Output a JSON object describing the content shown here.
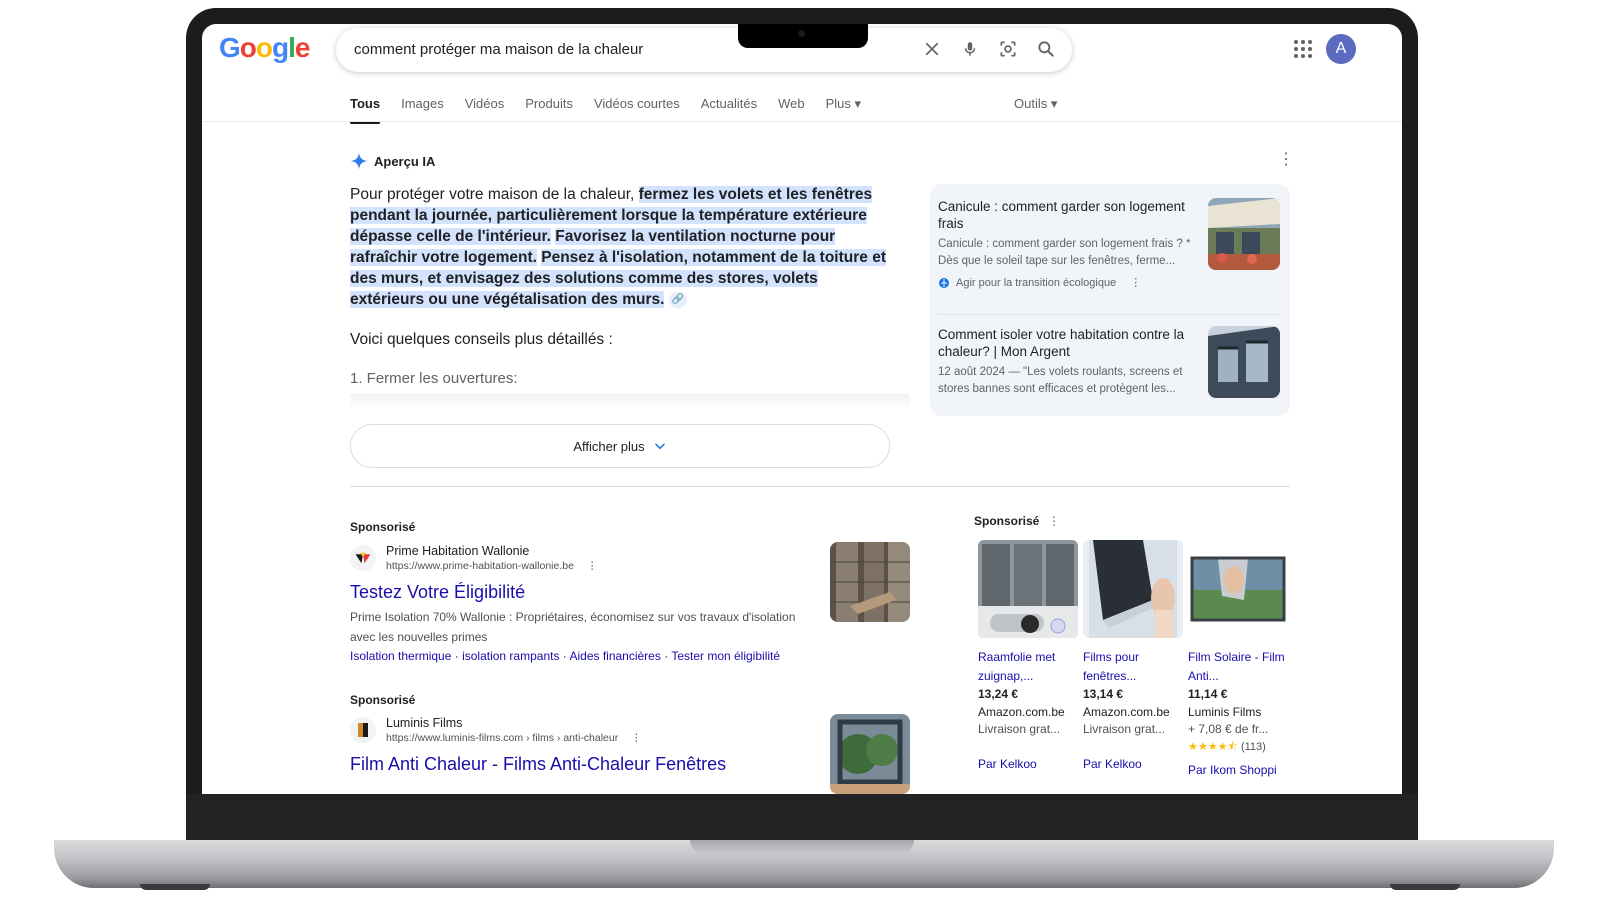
{
  "logo": {
    "letters": [
      "G",
      "o",
      "o",
      "g",
      "l",
      "e"
    ],
    "colors": [
      "#4285F4",
      "#EA4335",
      "#FBBC05",
      "#4285F4",
      "#34A853",
      "#EA4335"
    ]
  },
  "search": {
    "query": "comment protéger ma maison de la chaleur"
  },
  "account": {
    "avatar_letter": "A",
    "avatar_color": "#5c6bc0"
  },
  "tabs": [
    {
      "label": "Tous",
      "active": true
    },
    {
      "label": "Images"
    },
    {
      "label": "Vidéos"
    },
    {
      "label": "Produits"
    },
    {
      "label": "Vidéos courtes"
    },
    {
      "label": "Actualités"
    },
    {
      "label": "Web"
    },
    {
      "label": "Plus ▾"
    }
  ],
  "tools_label": "Outils ▾",
  "ai_overview": {
    "title": "Aperçu IA",
    "intro": "Pour protéger votre maison de la chaleur, ",
    "highlights": [
      "fermez les volets et les fenêtres pendant la journée, particulièrement lorsque la température extérieure dépasse celle de l'intérieur.",
      "Favorisez la ventilation nocturne pour rafraîchir votre logement.",
      "Pensez à l'isolation, notamment de la toiture et des murs, et envisagez des solutions comme des stores, volets extérieurs ou une végétalisation des murs."
    ],
    "subheading": "Voici quelques conseils plus détaillés :",
    "first_item": "1. Fermer les ouvertures:",
    "show_more": "Afficher plus"
  },
  "sources": [
    {
      "title": "Canicule : comment garder son logement frais",
      "snippet": "Canicule : comment garder son logement frais ? * Dès que le soleil tape sur les fenêtres, ferme...",
      "site": "Agir pour la transition écologique"
    },
    {
      "title": "Comment isoler votre habitation contre la chaleur? | Mon Argent",
      "snippet": "12 août 2024 — \"Les volets roulants, screens et stores bannes sont efficaces et protègent les..."
    }
  ],
  "ads": [
    {
      "label": "Sponsorisé",
      "advertiser": "Prime Habitation Wallonie",
      "url": "https://www.prime-habitation-wallonie.be",
      "title": "Testez Votre Éligibilité",
      "description": "Prime Isolation 70% Wallonie : Propriétaires, économisez sur vos travaux d'isolation avec les nouvelles primes",
      "sitelinks": [
        "Isolation thermique",
        "isolation rampants",
        "Aides financières",
        "Tester mon éligibilité"
      ]
    },
    {
      "label": "Sponsorisé",
      "advertiser": "Luminis Films",
      "url": "https://www.luminis-films.com › films › anti-chaleur",
      "title": "Film Anti Chaleur - Films Anti-Chaleur Fenêtres"
    }
  ],
  "shopping": {
    "label": "Sponsorisé",
    "products": [
      {
        "name": "Raamfolie met zuignap,...",
        "price": "13,24 €",
        "store": "Amazon.com.be",
        "shipping": "Livraison grat...",
        "by": "Par Kelkoo"
      },
      {
        "name": "Films pour fenêtres...",
        "price": "13,14 €",
        "store": "Amazon.com.be",
        "shipping": "Livraison grat...",
        "by": "Par Kelkoo"
      },
      {
        "name": "Film Solaire - Film Anti...",
        "price": "11,14 €",
        "store": "Luminis Films",
        "shipping": "+ 7,08 € de fr...",
        "rating": 4.5,
        "reviews": "(113)",
        "by": "Par Ikom Shoppi"
      }
    ]
  }
}
